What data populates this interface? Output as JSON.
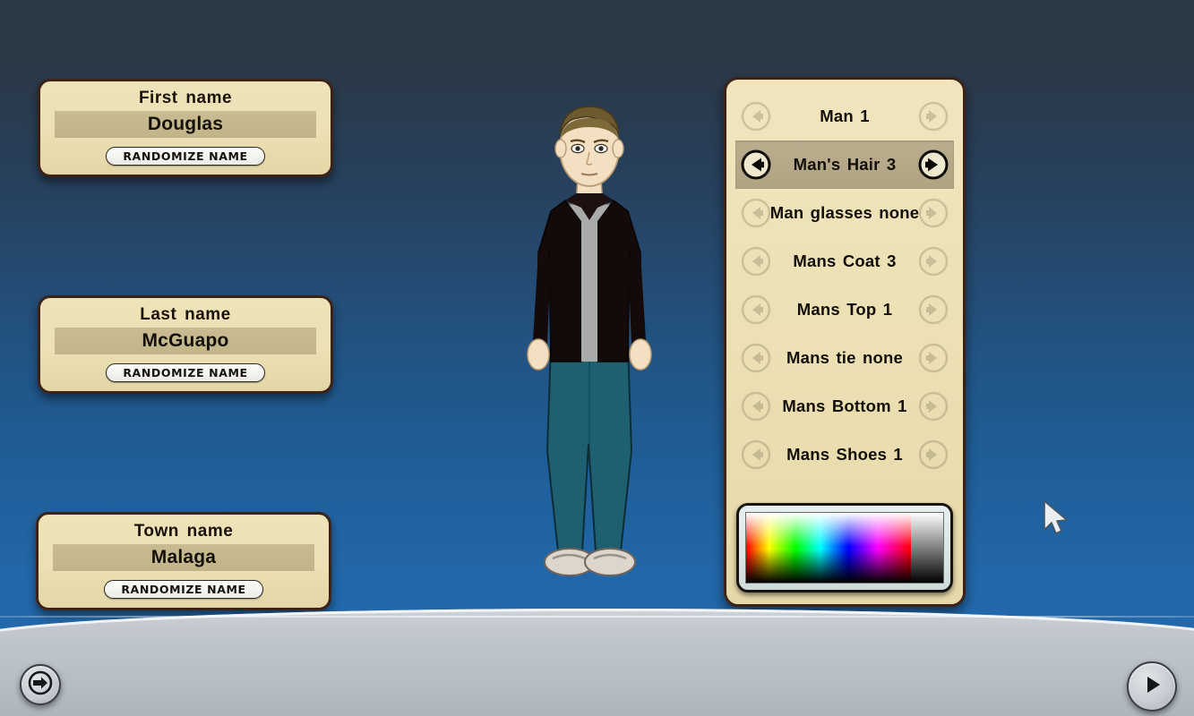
{
  "theme": {
    "bg_top": "#2b3845",
    "bg_bottom": "#2268aa",
    "panel_bg": "#ece0b4",
    "panel_border": "#3d2218",
    "value_bar": "#c5b78c",
    "selected_row": "#b5a886",
    "bottom_bar": "#c3c8cf"
  },
  "name_panels": [
    {
      "label": "First name",
      "value": "Douglas",
      "button": "RANDOMIZE NAME",
      "key": "first-name"
    },
    {
      "label": "Last name",
      "value": "McGuapo",
      "button": "RANDOMIZE NAME",
      "key": "last-name"
    },
    {
      "label": "Town name",
      "value": "Malaga",
      "button": "RANDOMIZE NAME",
      "key": "town-name"
    }
  ],
  "options": {
    "rows": [
      {
        "label": "Man 1",
        "selected": false,
        "key": "man"
      },
      {
        "label": "Man's Hair 3",
        "selected": true,
        "key": "mans-hair"
      },
      {
        "label": "Man glasses none",
        "selected": false,
        "key": "man-glasses"
      },
      {
        "label": "Mans Coat 3",
        "selected": false,
        "key": "mans-coat"
      },
      {
        "label": "Mans Top 1",
        "selected": false,
        "key": "mans-top"
      },
      {
        "label": "Mans tie none",
        "selected": false,
        "key": "mans-tie"
      },
      {
        "label": "Mans Bottom 1",
        "selected": false,
        "key": "mans-bottom"
      },
      {
        "label": "Mans Shoes 1",
        "selected": false,
        "key": "mans-shoes"
      }
    ],
    "prev_icon": "arrow-left-icon",
    "next_icon": "arrow-right-icon"
  },
  "color_picker": {
    "name": "color-picker",
    "hue_gradient": [
      "#ff0000",
      "#ffff00",
      "#00ff00",
      "#00ffff",
      "#0000ff",
      "#ff00ff",
      "#ff0000"
    ],
    "grayscale_strip": [
      "#ffffff",
      "#808080",
      "#000000"
    ]
  },
  "character": {
    "hair_color": "#6b5a2e",
    "skin_color": "#f3e0c2",
    "jacket_color": "#140a0a",
    "shirt_color": "#a9abaa",
    "pants_color": "#1f6070",
    "shoes_color": "#ded6cc"
  },
  "nav": {
    "exit_icon": "exit-arrow-icon",
    "next_icon": "play-arrow-icon"
  },
  "cursor": {
    "icon": "mouse-pointer-icon"
  }
}
